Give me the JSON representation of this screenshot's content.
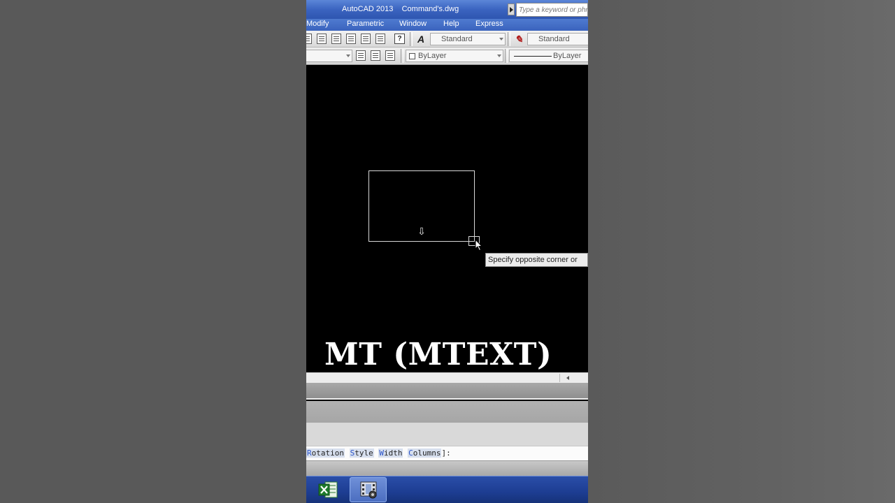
{
  "window": {
    "title": "AutoCAD 2013    Command's.dwg",
    "search_placeholder": "Type a keyword or phr"
  },
  "menu": {
    "items": [
      "Modify",
      "Parametric",
      "Window",
      "Help",
      "Express"
    ]
  },
  "toolbar": {
    "text_style_value": "Standard",
    "dim_style_value": "Standard",
    "color_value": "ByLayer",
    "linetype_value": "ByLayer",
    "help_label": "?",
    "text_style_icon": "A"
  },
  "canvas": {
    "tooltip": "Specify opposite corner or",
    "caption": "MT (MTEXT)"
  },
  "command_line": {
    "options": [
      {
        "prefix": "",
        "key": "R",
        "rest": "otation"
      },
      {
        "prefix": "",
        "key": "S",
        "rest": "tyle"
      },
      {
        "prefix": "",
        "key": "W",
        "rest": "idth"
      },
      {
        "prefix": "",
        "key": "C",
        "rest": "olumns"
      }
    ],
    "suffix": "]:"
  },
  "taskbar": {
    "apps": [
      "excel-icon",
      "autocad-film-icon"
    ]
  },
  "colors": {
    "titlebar": "#3b64c0",
    "canvas_bg": "#000000",
    "taskbar": "#1d3d92"
  }
}
